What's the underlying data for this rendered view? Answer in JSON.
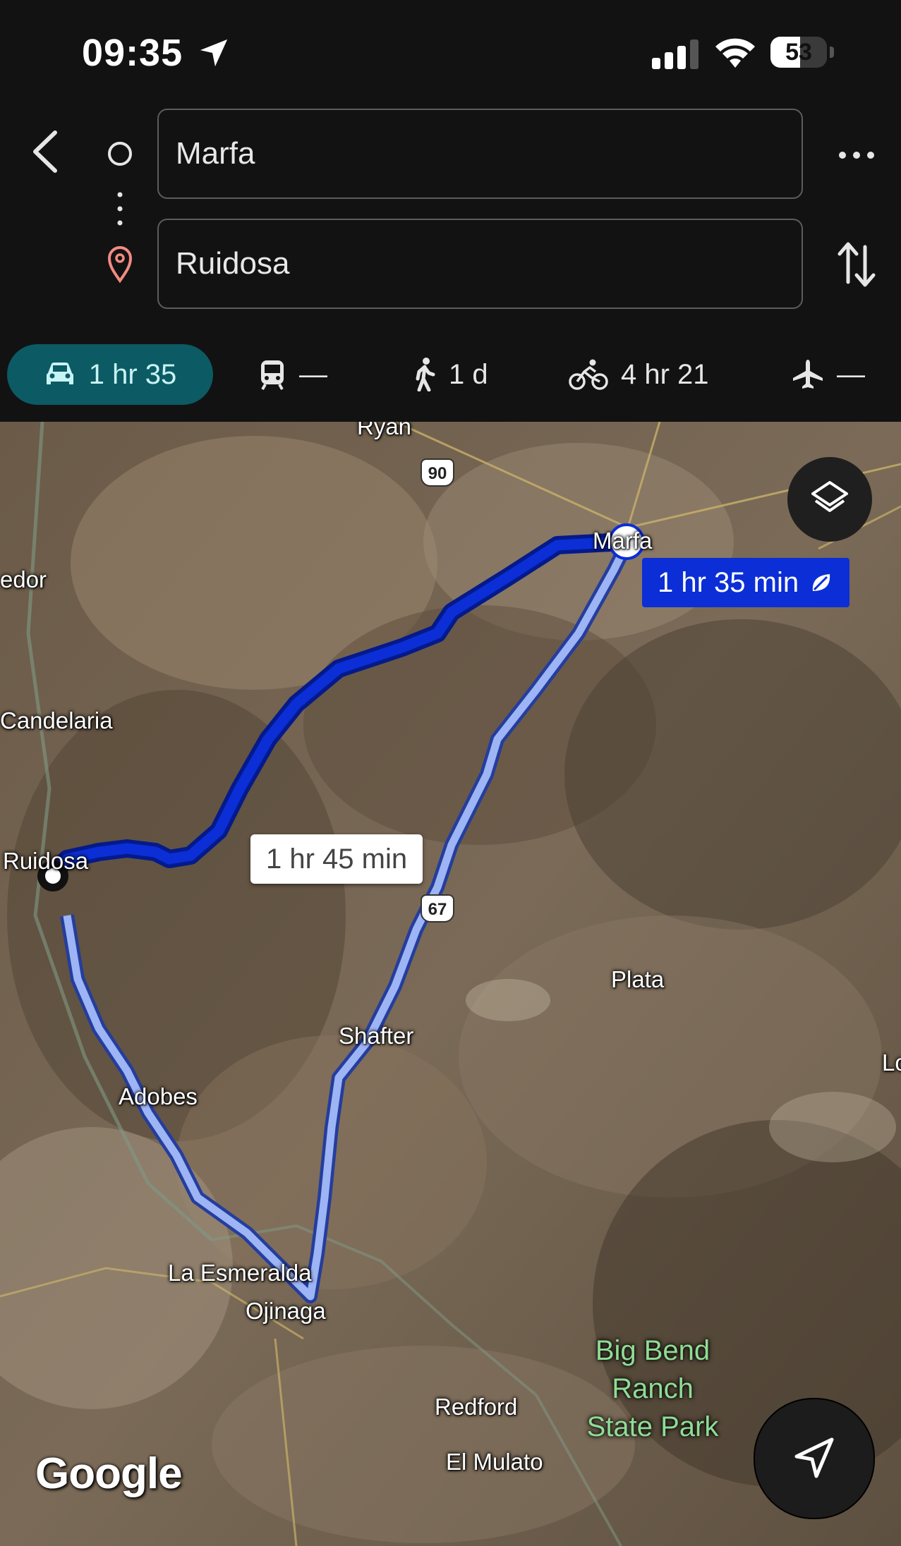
{
  "status_bar": {
    "time": "09:35",
    "battery": "53",
    "battery_level": 0.53
  },
  "directions": {
    "origin": "Marfa",
    "destination": "Ruidosa",
    "modes": [
      {
        "name": "drive",
        "label": "1 hr 35",
        "selected": true
      },
      {
        "name": "transit",
        "label": "—"
      },
      {
        "name": "walk",
        "label": "1 d"
      },
      {
        "name": "bike",
        "label": "4 hr 21"
      },
      {
        "name": "flight",
        "label": "—"
      }
    ]
  },
  "map": {
    "route_labels": {
      "main": "1 hr 35 min",
      "alternate": "1 hr 45 min"
    },
    "places": {
      "ryan": "Ryan",
      "marfa": "Marfa",
      "redor": "edor",
      "candelaria": "Candelaria",
      "ruidosa": "Ruidosa",
      "plata": "Plata",
      "shafter": "Shafter",
      "adobes": "Adobes",
      "la_esmeralda": "La Esmeralda",
      "ojinaga": "Ojinaga",
      "redford": "Redford",
      "el_mulato": "El Mulato",
      "lo": "Lo"
    },
    "park": [
      "Big Bend",
      "Ranch",
      "State Park"
    ],
    "shields": {
      "us90": "90",
      "us67": "67"
    },
    "logo": "Google"
  },
  "colors": {
    "route_main": "#0b2ed6",
    "route_alt": "#9db4f5",
    "mode_selected": "#0c5a64"
  }
}
